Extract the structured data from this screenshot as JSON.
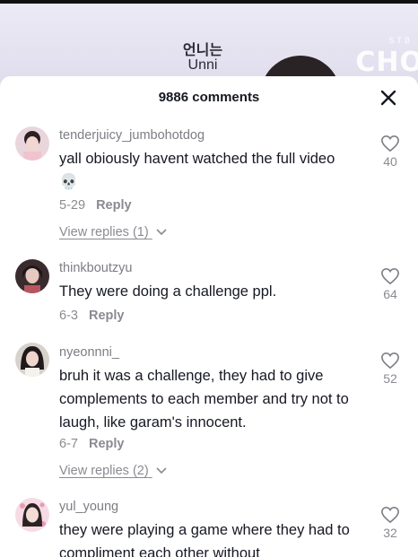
{
  "video": {
    "caption_ko": "언니는",
    "caption_en": "Unni",
    "brand": "CHO",
    "brand_small": "STB"
  },
  "sheet": {
    "title": "9886 comments"
  },
  "comments": [
    {
      "username": "tenderjuicy_jumbohotdog",
      "text": "yall obiously havent watched the full video",
      "emoji": "💀",
      "date": "5-29",
      "reply_label": "Reply",
      "likes": "40",
      "view_replies": "View replies (1)"
    },
    {
      "username": "thinkboutzyu",
      "text": "They were doing a challenge ppl.",
      "date": "6-3",
      "reply_label": "Reply",
      "likes": "64"
    },
    {
      "username": "nyeonnni_",
      "text": "bruh it was a challenge, they had to give complements to each member and try not to laugh, like garam's innocent.",
      "date": "6-7",
      "reply_label": "Reply",
      "likes": "52",
      "view_replies": "View replies (2)"
    },
    {
      "username": "yul_young",
      "text": "they were playing a game where they had to compliment each other without",
      "likes": "32"
    }
  ],
  "colors": {
    "text": "#161823",
    "secondary": "#8a8b91",
    "username": "#7d7d85"
  }
}
